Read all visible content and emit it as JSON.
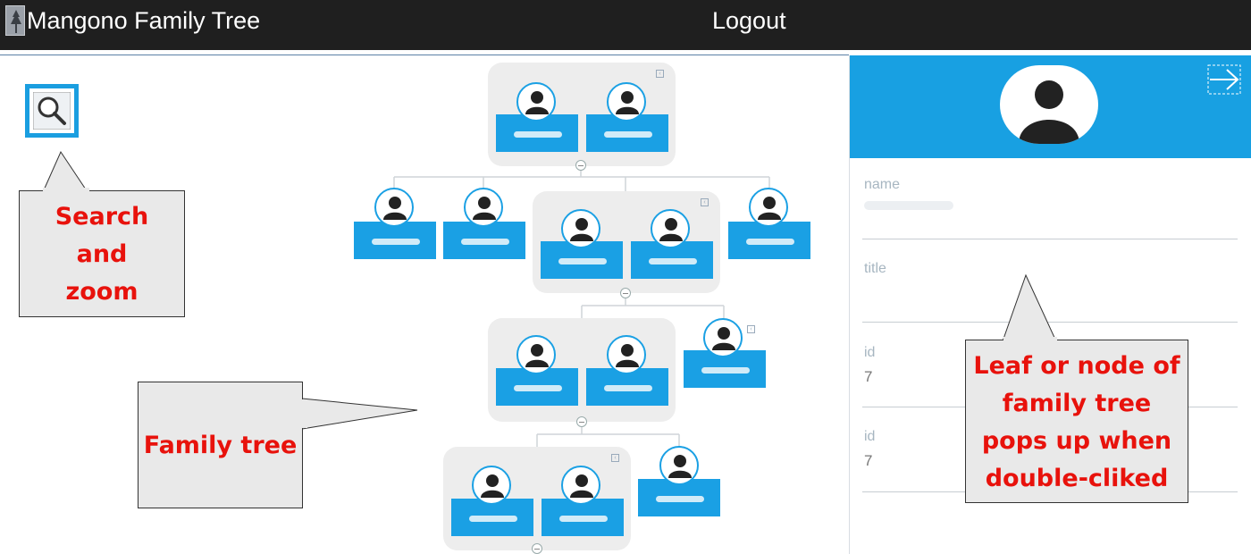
{
  "header": {
    "title": "Mangono Family Tree",
    "logout": "Logout"
  },
  "callouts": {
    "search": [
      "Search",
      "and",
      "zoom"
    ],
    "tree": "Family tree",
    "leaf": [
      "Leaf or node of",
      "family tree",
      "pops up when",
      "double-cliked"
    ]
  },
  "details": {
    "fields": [
      {
        "label": "name",
        "value": ""
      },
      {
        "label": "title",
        "value": ""
      },
      {
        "label": "id",
        "value": "7"
      },
      {
        "label": "id",
        "value": "7"
      }
    ]
  },
  "colors": {
    "header_bg": "#1f1f1f",
    "accent": "#1aa0e4",
    "callout_text": "#e8120c",
    "callout_bg": "#e9e9e9"
  },
  "icons": [
    "search-icon",
    "person-icon",
    "arrow-right-icon",
    "collapse-icon",
    "tree-logo-icon"
  ]
}
